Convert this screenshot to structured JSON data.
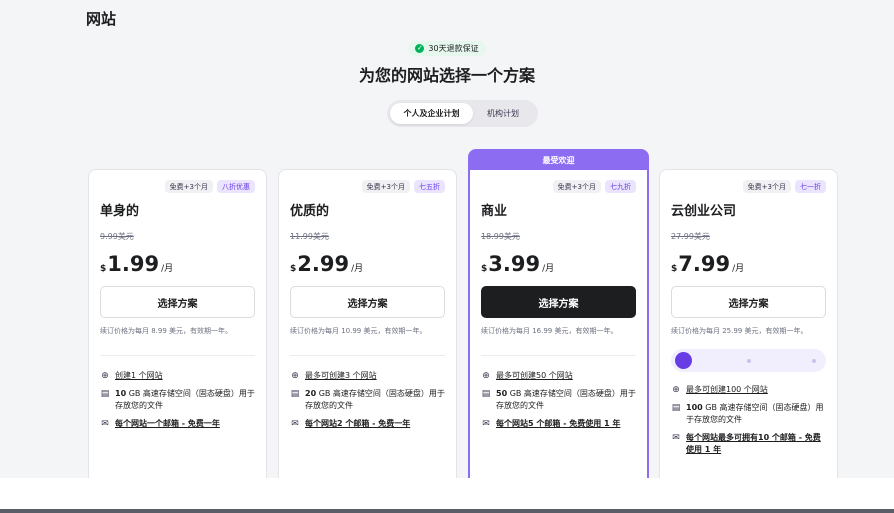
{
  "page": {
    "title": "网站",
    "guarantee": "30天退款保证",
    "headline": "为您的网站选择一个方案"
  },
  "toggle": {
    "personal": "个人及企业计划",
    "agency": "机构计划"
  },
  "featured_label": "最受欢迎",
  "plans": [
    {
      "badge_free": "免费+3个月",
      "badge_discount": "八折优惠",
      "name": "单身的",
      "old_price": "9.99美元",
      "currency": "$",
      "price": "1.99",
      "per": "/月",
      "cta": "选择方案",
      "renew": "续订价格为每月 8.99 美元，有效期一年。",
      "f1_pre": "",
      "f1_link": "创建1 个网站",
      "f2_bold": "10",
      "f2_rest": "GB 高速存储空间（固态硬盘）用于存放您的文件",
      "f3_link": "每个网站一个邮箱 - 免费一年"
    },
    {
      "badge_free": "免费+3个月",
      "badge_discount": "七五折",
      "name": "优质的",
      "old_price": "11.99美元",
      "currency": "$",
      "price": "2.99",
      "per": "/月",
      "cta": "选择方案",
      "renew": "续订价格为每月 10.99 美元，有效期一年。",
      "f1_link": "最多可创建3 个网站",
      "f2_bold": "20",
      "f2_rest": "GB 高速存储空间（固态硬盘）用于存放您的文件",
      "f3_link": "每个网站2 个邮箱 - 免费一年"
    },
    {
      "badge_free": "免费+3个月",
      "badge_discount": "七九折",
      "name": "商业",
      "old_price": "18.99美元",
      "currency": "$",
      "price": "3.99",
      "per": "/月",
      "cta": "选择方案",
      "renew": "续订价格为每月 16.99 美元，有效期一年。",
      "f1_link": "最多可创建50 个网站",
      "f2_bold": "50",
      "f2_rest": "GB 高速存储空间（固态硬盘）用于存放您的文件",
      "f3_link": "每个网站5 个邮箱 - 免费使用 1 年"
    },
    {
      "badge_free": "免费+3个月",
      "badge_discount": "七一折",
      "name": "云创业公司",
      "old_price": "27.99美元",
      "currency": "$",
      "price": "7.99",
      "per": "/月",
      "cta": "选择方案",
      "renew": "续订价格为每月 25.99 美元，有效期一年。",
      "f1_link": "最多可创建100 个网站",
      "f2_bold": "100",
      "f2_rest": "GB 高速存储空间（固态硬盘）用于存放您的文件",
      "f3_link": "每个网站最多可拥有10 个邮箱 - 免费使用 1 年"
    }
  ],
  "colors": {
    "accent": "#673de6",
    "featured": "#8c6df2",
    "dark_button": "#1d1e20",
    "check": "#00b35a"
  },
  "icons": {
    "guarantee": "check-circle-icon",
    "website": "globe-icon",
    "storage": "database-icon",
    "email": "mail-icon"
  }
}
